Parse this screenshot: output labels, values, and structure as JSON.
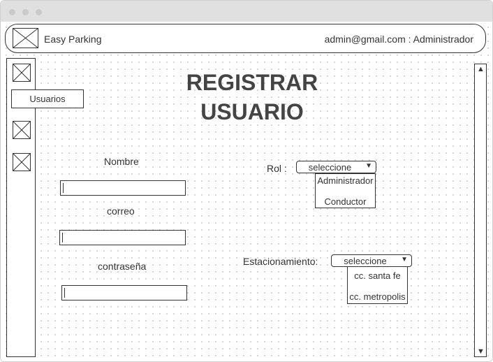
{
  "header": {
    "app_title": "Easy Parking",
    "user_info": "admin@gmail.com : Administrador"
  },
  "sidebar": {
    "items": [
      {
        "icon": "image-placeholder-icon"
      },
      {
        "label": "Usuarios"
      },
      {
        "icon": "image-placeholder-icon"
      },
      {
        "icon": "image-placeholder-icon"
      }
    ]
  },
  "page": {
    "title_line1": "REGISTRAR",
    "title_line2": "USUARIO"
  },
  "form": {
    "nombre_label": "Nombre",
    "correo_label": "correo",
    "contrasena_label": "contraseña",
    "rol_label": "Rol :",
    "rol_select": "seleccione",
    "rol_options": [
      "Administrador",
      "Conductor"
    ],
    "estacionamiento_label": "Estacionamiento:",
    "estacionamiento_select": "seleccione",
    "estacionamiento_options": [
      "cc. santa fe",
      "cc. metropolis"
    ]
  },
  "scrollbar": {
    "up_arrow": "▲",
    "down_arrow": "▼"
  },
  "icons": {
    "dropdown_arrow": "▼"
  },
  "colors": {
    "titlebar": "#e0e0e0",
    "border": "#333333",
    "dot_grid": "#c9c9c9"
  }
}
